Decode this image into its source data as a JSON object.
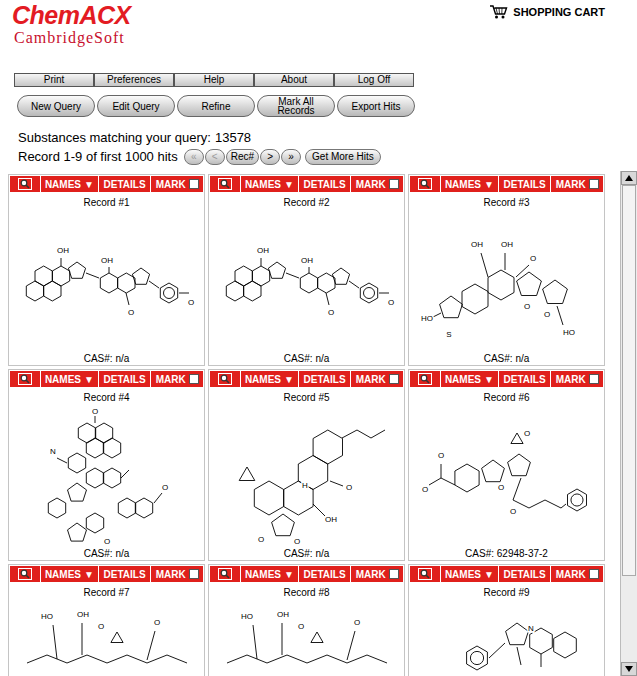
{
  "header": {
    "logo": "ChemACX",
    "company": "CambridgeSoft",
    "cart": "SHOPPING CART"
  },
  "toolbar": [
    "Print",
    "Preferences",
    "Help",
    "About",
    "Log Off"
  ],
  "actions": [
    "New Query",
    "Edit Query",
    "Refine",
    "Mark All Records",
    "Export Hits"
  ],
  "summary": {
    "label": "Substances matching your query:",
    "count": "13578"
  },
  "paging": {
    "range": "Record 1-9 of first 1000 hits",
    "buttons": [
      {
        "label": "«",
        "disabled": true
      },
      {
        "label": "<",
        "disabled": true
      },
      {
        "label": "Rec#",
        "disabled": false
      },
      {
        "label": ">",
        "disabled": false
      },
      {
        "label": "»",
        "disabled": false
      }
    ],
    "more": "Get More Hits"
  },
  "card_menu": {
    "names": "NAMES",
    "names_arrow": "▼",
    "details": "DETAILS",
    "mark": "MARK"
  },
  "records": [
    {
      "title": "Record #1",
      "cas": "CAS#: n/a",
      "marked": false,
      "structure": "dimer",
      "labels": [
        "OH",
        "OH",
        "O",
        "O"
      ]
    },
    {
      "title": "Record #2",
      "cas": "CAS#: n/a",
      "marked": false,
      "structure": "dimer",
      "labels": [
        "OH",
        "OH",
        "O",
        "O"
      ]
    },
    {
      "title": "Record #3",
      "cas": "CAS#: n/a",
      "marked": false,
      "structure": "spiro",
      "labels": [
        "OH",
        "OH",
        "O",
        "HO",
        "S",
        "O",
        "O",
        "HO"
      ]
    },
    {
      "title": "Record #4",
      "cas": "CAS#: n/a",
      "marked": false,
      "structure": "cage",
      "labels": [
        "O",
        "N",
        "O",
        "O"
      ]
    },
    {
      "title": "Record #5",
      "cas": "CAS#: n/a",
      "marked": false,
      "structure": "diterpene",
      "labels": [
        "H",
        "OH",
        "O",
        "O",
        "O"
      ]
    },
    {
      "title": "Record #6",
      "cas": "CAS#: 62948-37-2",
      "marked": false,
      "structure": "ester",
      "labels": [
        "O",
        "O",
        "O",
        "O",
        "O"
      ]
    },
    {
      "title": "Record #7",
      "marked": false,
      "structure": "macrocycle",
      "labels": [
        "HO",
        "OH",
        "O",
        "O"
      ]
    },
    {
      "title": "Record #8",
      "marked": false,
      "structure": "macrocycle",
      "labels": [
        "HO",
        "OH",
        "O",
        "O"
      ]
    },
    {
      "title": "Record #9",
      "marked": false,
      "structure": "alkaloid",
      "labels": [
        "N"
      ]
    }
  ],
  "scrollbar": {
    "level": 0.82
  }
}
